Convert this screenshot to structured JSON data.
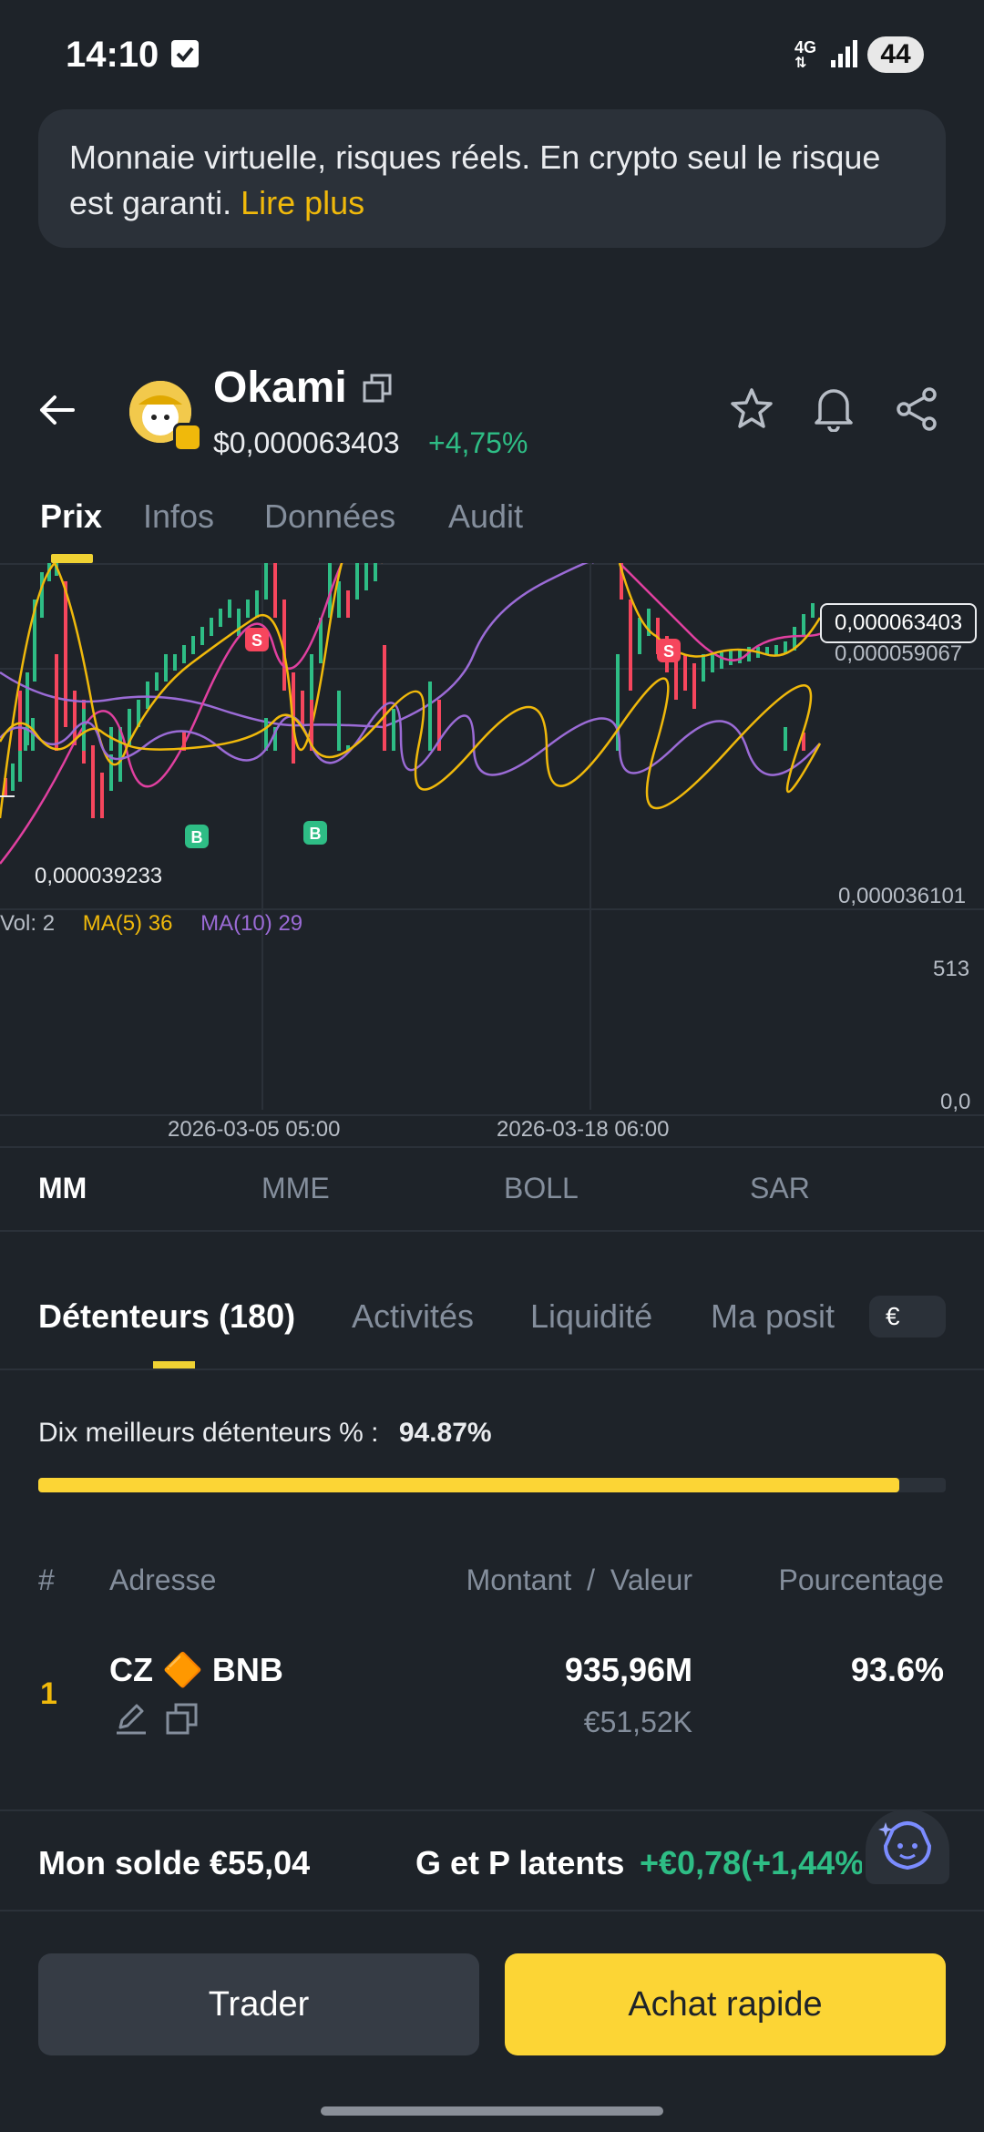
{
  "status_bar": {
    "time": "14:10",
    "network": "4G",
    "battery": "44"
  },
  "banner": {
    "text": "Monnaie virtuelle, risques réels. En crypto seul le risque est garanti. ",
    "link": "Lire plus"
  },
  "header": {
    "token_name": "Okami",
    "price": "$0,000063403",
    "change": "+4,75%"
  },
  "main_tabs": [
    "Prix",
    "Infos",
    "Données",
    "Audit"
  ],
  "chart": {
    "price_current": "0,000063403",
    "price_level2": "0,000059067",
    "price_low_marker": "0,000039233",
    "price_axis_min": "0,000036101",
    "volume_legend": {
      "vol": "Vol: 2",
      "ma5": "MA(5) 36",
      "ma10": "MA(10) 29"
    },
    "volume_axis_max": "513",
    "volume_axis_min": "0,0",
    "date_labels": [
      "2026-03-05 05:00",
      "2026-03-18 06:00"
    ],
    "markers": [
      "S",
      "B",
      "B",
      "S"
    ],
    "colors": {
      "up": "#2ebd85",
      "down": "#f6465d",
      "ma5": "#f0b90b",
      "ma10": "#e040a0",
      "ma20": "#9b6bd6"
    }
  },
  "indicator_tabs": [
    "MM",
    "MME",
    "BOLL",
    "SAR"
  ],
  "holder_tabs": [
    "Détenteurs (180)",
    "Activités",
    "Liquidité",
    "Ma posit"
  ],
  "currency": "€",
  "top10": {
    "label": "Dix meilleurs détenteurs % :",
    "value": "94.87%",
    "fraction": 0.9487
  },
  "table": {
    "headers": {
      "num": "#",
      "address": "Adresse",
      "amount": "Montant",
      "sep": "/",
      "value": "Valeur",
      "pct": "Pourcentage"
    },
    "rows": [
      {
        "num": "1",
        "address": "CZ 🔶 BNB",
        "amount": "935,96M",
        "value": "€51,52K",
        "pct": "93.6%"
      }
    ]
  },
  "footer": {
    "balance": "Mon solde €55,04",
    "pnl_label": "G et P latents",
    "pnl_value": "+€0,78(+1,44%)"
  },
  "actions": {
    "trade": "Trader",
    "buy": "Achat rapide"
  }
}
